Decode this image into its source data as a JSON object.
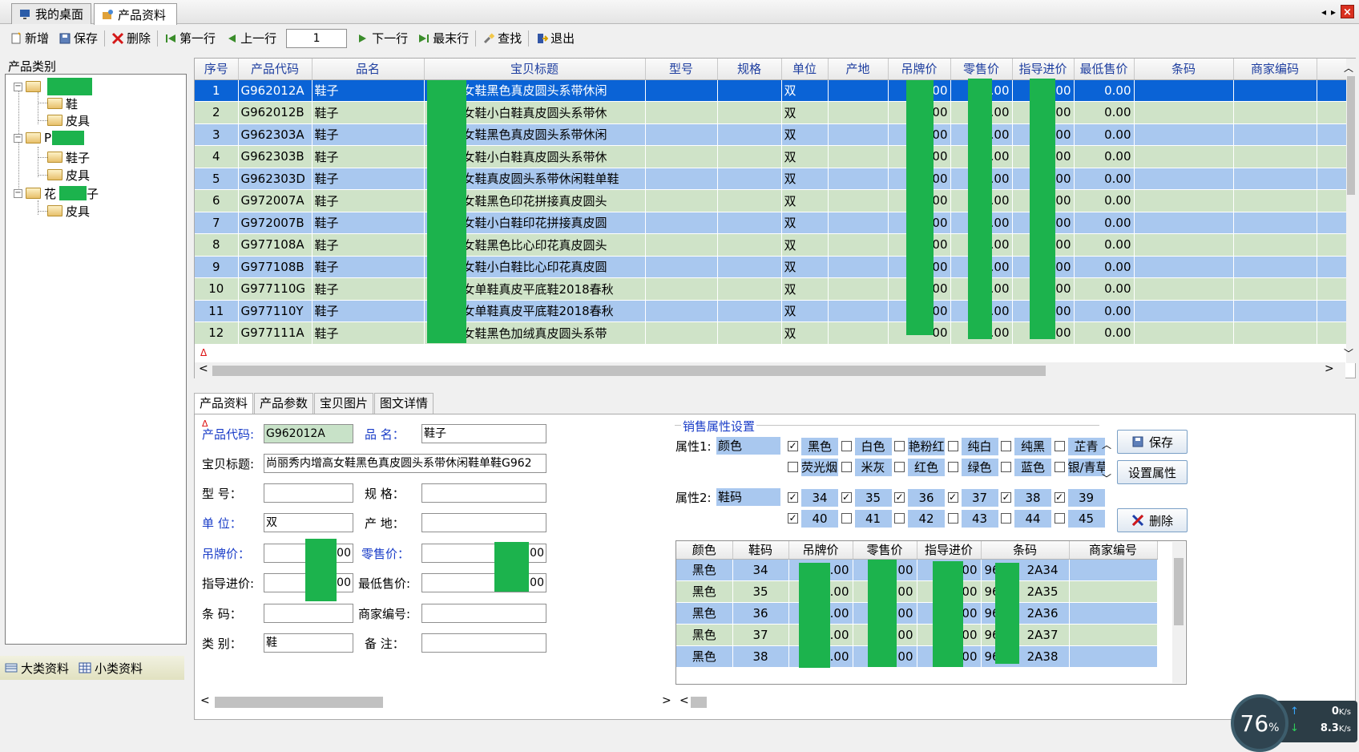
{
  "tabs": [
    {
      "label": "我的桌面",
      "icon": "desktop-icon"
    },
    {
      "label": "产品资料",
      "icon": "product-box-icon"
    }
  ],
  "window_controls": {
    "prev": "◂",
    "next": "▸",
    "close": "×"
  },
  "toolbar": {
    "new": "新增",
    "save": "保存",
    "delete": "删除",
    "first": "第一行",
    "prev": "上一行",
    "row_value": "1",
    "next": "下一行",
    "last": "最末行",
    "find": "查找",
    "exit": "退出"
  },
  "tree": {
    "header": "产品类别",
    "nodes": [
      {
        "label": ""
      },
      {
        "label": "鞋"
      },
      {
        "label": "皮具"
      },
      {
        "label": "P"
      },
      {
        "label": "鞋子"
      },
      {
        "label": "皮具"
      },
      {
        "label": "花",
        "suffix": "子"
      },
      {
        "label": "皮具"
      }
    ]
  },
  "left_bottom": {
    "major": "大类资料",
    "minor": "小类资料"
  },
  "grid": {
    "columns": [
      "序号",
      "产品代码",
      "品名",
      "宝贝标题",
      "型号",
      "规格",
      "单位",
      "产地",
      "吊牌价",
      "零售价",
      "指导进价",
      "最低售价",
      "条码",
      "商家编码"
    ],
    "rows": [
      {
        "no": "1",
        "code": "G962012A",
        "name": "鞋子",
        "title": "内增高女鞋黑色真皮圆头系带休闲",
        "unit": "双",
        "tag": "00",
        "retail": ".00",
        "guide": "00",
        "min": "0.00"
      },
      {
        "no": "2",
        "code": "G962012B",
        "name": "鞋子",
        "title": "内增高女鞋小白鞋真皮圆头系带休",
        "unit": "双",
        "tag": "00",
        "retail": ".00",
        "guide": "00",
        "min": "0.00"
      },
      {
        "no": "3",
        "code": "G962303A",
        "name": "鞋子",
        "title": "内增高女鞋黑色真皮圆头系带休闲",
        "unit": "双",
        "tag": "00",
        "retail": ".00",
        "guide": "00",
        "min": "0.00"
      },
      {
        "no": "4",
        "code": "G962303B",
        "name": "鞋子",
        "title": "内增高女鞋小白鞋真皮圆头系带休",
        "unit": "双",
        "tag": "00",
        "retail": ".00",
        "guide": "00",
        "min": "0.00"
      },
      {
        "no": "5",
        "code": "G962303D",
        "name": "鞋子",
        "title": "内增高女鞋真皮圆头系带休闲鞋单鞋",
        "unit": "双",
        "tag": "00",
        "retail": ".00",
        "guide": "00",
        "min": "0.00"
      },
      {
        "no": "6",
        "code": "G972007A",
        "name": "鞋子",
        "title": "内增高女鞋黑色印花拼接真皮圆头",
        "unit": "双",
        "tag": "00",
        "retail": ".00",
        "guide": "00",
        "min": "0.00"
      },
      {
        "no": "7",
        "code": "G972007B",
        "name": "鞋子",
        "title": "内增高女鞋小白鞋印花拼接真皮圆",
        "unit": "双",
        "tag": "00",
        "retail": ".00",
        "guide": "00",
        "min": "0.00"
      },
      {
        "no": "8",
        "code": "G977108A",
        "name": "鞋子",
        "title": "内增高女鞋黑色比心印花真皮圆头",
        "unit": "双",
        "tag": "00",
        "retail": ".00",
        "guide": "00",
        "min": "0.00"
      },
      {
        "no": "9",
        "code": "G977108B",
        "name": "鞋子",
        "title": "内增高女鞋小白鞋比心印花真皮圆",
        "unit": "双",
        "tag": "00",
        "retail": ".00",
        "guide": "00",
        "min": "0.00"
      },
      {
        "no": "10",
        "code": "G977110G",
        "name": "鞋子",
        "title": "小白鞋女单鞋真皮平底鞋2018春秋",
        "unit": "双",
        "tag": "00",
        "retail": ".00",
        "guide": "00",
        "min": "0.00"
      },
      {
        "no": "11",
        "code": "G977110Y",
        "name": "鞋子",
        "title": "小白鞋女单鞋真皮平底鞋2018春秋",
        "unit": "双",
        "tag": "00",
        "retail": ".00",
        "guide": "00",
        "min": "0.00"
      },
      {
        "no": "12",
        "code": "G977111A",
        "name": "鞋子",
        "title": "内增高女鞋黑色加绒真皮圆头系带",
        "unit": "双",
        "tag": "00",
        "retail": ".00",
        "guide": "00",
        "min": "0.00"
      }
    ]
  },
  "bottom_tabs": [
    "产品资料",
    "产品参数",
    "宝贝图片",
    "图文详情"
  ],
  "form": {
    "code_label": "产品代码:",
    "code_value": "G962012A",
    "name_label": "品    名：",
    "name_value": "鞋子",
    "title_label": "宝贝标题:",
    "title_value": "尚丽秀内增高女鞋黑色真皮圆头系带休闲鞋单鞋G962",
    "model_label": "型    号：",
    "model_value": "",
    "spec_label": "规    格：",
    "spec_value": "",
    "unit_label": "单    位：",
    "unit_value": "双",
    "origin_label": "产    地：",
    "origin_value": "",
    "tag_label": "吊牌价：",
    "tag_value": ".00",
    "retail_label": "零售价：",
    "retail_value": "00",
    "guide_label": "指导进价:",
    "guide_value": ".00",
    "min_label": "最低售价:",
    "min_value": "00",
    "barcode_label": "条    码：",
    "barcode_value": "",
    "merchant_label": "商家编号:",
    "merchant_value": "",
    "category_label": "类    别：",
    "category_value": "鞋",
    "remark_label": "备    注：",
    "remark_value": ""
  },
  "sales_attr": {
    "title": "销售属性设置",
    "attr1_label": "属性1:",
    "attr1_value": "颜色",
    "attr2_label": "属性2:",
    "attr2_value": "鞋码",
    "colors_row1": [
      {
        "label": "黑色",
        "checked": true
      },
      {
        "label": "白色",
        "checked": false
      },
      {
        "label": "艳粉红",
        "checked": false
      },
      {
        "label": "纯白",
        "checked": false
      },
      {
        "label": "纯黑",
        "checked": false
      },
      {
        "label": "芷青",
        "checked": false
      }
    ],
    "colors_row2": [
      {
        "label": "荧光烟灰",
        "checked": false
      },
      {
        "label": "米灰",
        "checked": false
      },
      {
        "label": "红色",
        "checked": false
      },
      {
        "label": "绿色",
        "checked": false
      },
      {
        "label": "蓝色",
        "checked": false
      },
      {
        "label": "银/青草",
        "checked": false
      }
    ],
    "sizes_row1": [
      {
        "label": "34",
        "checked": true
      },
      {
        "label": "35",
        "checked": true
      },
      {
        "label": "36",
        "checked": true
      },
      {
        "label": "37",
        "checked": true
      },
      {
        "label": "38",
        "checked": true
      },
      {
        "label": "39",
        "checked": true
      }
    ],
    "sizes_row2": [
      {
        "label": "40",
        "checked": true
      },
      {
        "label": "41",
        "checked": false
      },
      {
        "label": "42",
        "checked": false
      },
      {
        "label": "43",
        "checked": false
      },
      {
        "label": "44",
        "checked": false
      },
      {
        "label": "45",
        "checked": false
      }
    ],
    "save_btn": "保存",
    "set_attr_btn": "设置属性",
    "delete_btn": "删除"
  },
  "subgrid": {
    "columns": [
      "颜色",
      "鞋码",
      "吊牌价",
      "零售价",
      "指导进价",
      "条码",
      "商家编号"
    ],
    "rows": [
      {
        "color": "黑色",
        "size": "34",
        "tag": ".00",
        "retail": ".00",
        "guide": "00",
        "barcode": "96",
        "barcode2": "2A34"
      },
      {
        "color": "黑色",
        "size": "35",
        "tag": ".00",
        "retail": ".00",
        "guide": "00",
        "barcode": "96",
        "barcode2": "2A35"
      },
      {
        "color": "黑色",
        "size": "36",
        "tag": ".00",
        "retail": ".00",
        "guide": "00",
        "barcode": "96",
        "barcode2": "2A36"
      },
      {
        "color": "黑色",
        "size": "37",
        "tag": ".00",
        "retail": ".00",
        "guide": "00",
        "barcode": "96",
        "barcode2": "2A37"
      },
      {
        "color": "黑色",
        "size": "38",
        "tag": ".00",
        "retail": ".00",
        "guide": "00",
        "barcode": "96",
        "barcode2": "2A38"
      }
    ]
  },
  "speed": {
    "percent": "76",
    "percent_unit": "%",
    "up": "0",
    "up_unit": "K/s",
    "down": "8.3",
    "down_unit": "K/s"
  },
  "colors": {
    "selected_row": "#0a63d6",
    "row_green": "#cfe3c8",
    "row_blue": "#a9c8ef",
    "mask_green": "#1cb34d",
    "header_text": "#1f3fa0"
  }
}
